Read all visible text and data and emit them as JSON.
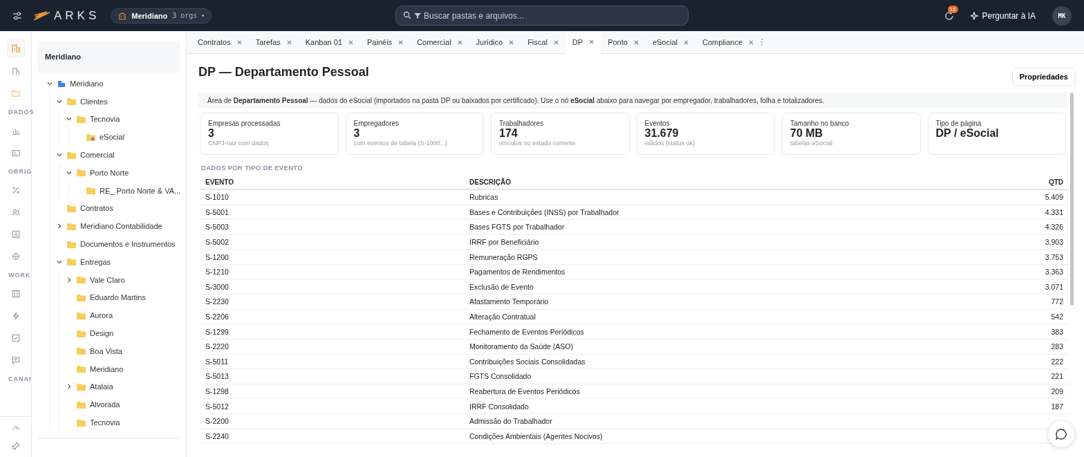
{
  "topbar": {
    "logo": "ARKS",
    "org": {
      "name": "Meridiano",
      "count": "3 orgs"
    },
    "search": {
      "placeholder": "Buscar pastas e arquivos..."
    },
    "notifications": "15",
    "ask_ai": "Perguntar à IA",
    "avatar": "MK"
  },
  "rail": {
    "sections": [
      "DADOS",
      "OBRIG",
      "WORK",
      "CANAI"
    ]
  },
  "tree": {
    "title": "Meridiano",
    "items": [
      {
        "label": "Meridiano",
        "kind": "org",
        "expanded": true,
        "children": [
          {
            "label": "Clientes",
            "kind": "folder",
            "expanded": true,
            "children": [
              {
                "label": "Tecnovia",
                "kind": "folder",
                "expanded": true,
                "children": [
                  {
                    "label": "eSocial",
                    "kind": "special"
                  }
                ]
              }
            ]
          },
          {
            "label": "Comercial",
            "kind": "folder",
            "expanded": true,
            "children": [
              {
                "label": "Porto Norte",
                "kind": "folder",
                "expanded": true,
                "children": [
                  {
                    "label": "RE_ Porto Norte & VA...",
                    "kind": "folder"
                  }
                ]
              }
            ]
          },
          {
            "label": "Contratos",
            "kind": "folder"
          },
          {
            "label": "Meridiano Contabilidade",
            "kind": "folder",
            "expanded": false
          },
          {
            "label": "Documentos e Instrumentos",
            "kind": "folder"
          },
          {
            "label": "Entregas",
            "kind": "folder",
            "expanded": true,
            "children": [
              {
                "label": "Vale Claro",
                "kind": "folder",
                "expanded": false
              },
              {
                "label": "Eduardo Martins",
                "kind": "folder"
              },
              {
                "label": "Aurora",
                "kind": "folder"
              },
              {
                "label": "Design",
                "kind": "folder"
              },
              {
                "label": "Boa Vista",
                "kind": "folder"
              },
              {
                "label": "Meridiano",
                "kind": "folder"
              },
              {
                "label": "Atalaia",
                "kind": "folder",
                "expanded": false
              },
              {
                "label": "Alvorada",
                "kind": "folder"
              },
              {
                "label": "Tecnovia",
                "kind": "folder"
              }
            ]
          }
        ]
      }
    ]
  },
  "tabs": [
    {
      "label": "Contratos",
      "selected": false
    },
    {
      "label": "Tarefas",
      "selected": false
    },
    {
      "label": "Kanban 01",
      "selected": false
    },
    {
      "label": "Painéis",
      "selected": false
    },
    {
      "label": "Comercial",
      "selected": false
    },
    {
      "label": "Jurídico",
      "selected": false
    },
    {
      "label": "Fiscal",
      "selected": false
    },
    {
      "label": "DP",
      "selected": true
    },
    {
      "label": "Ponto",
      "selected": false
    },
    {
      "label": "eSocial",
      "selected": false
    },
    {
      "label": "Compliance",
      "selected": false
    }
  ],
  "page": {
    "title": "DP — Departamento Pessoal",
    "properties_button": "Propriedades",
    "info": "Área de **Departamento Pessoal** — dados do eSocial (importados na pasta DP ou baixados por certificado). Use o nó **eSocial** abaixo para navegar por empregador, trabalhadores, folha e totalizadores.",
    "stats": [
      {
        "label": "Empresas processadas",
        "value": "3",
        "note": "CNPJ-raiz com dados"
      },
      {
        "label": "Empregadores",
        "value": "3",
        "note": "com eventos de tabela (S-1000...)"
      },
      {
        "label": "Trabalhadores",
        "value": "174",
        "note": "vínculos no estado corrente"
      },
      {
        "label": "Eventos",
        "value": "31.679",
        "note": "válidos (status ok)"
      },
      {
        "label": "Tamanho no banco",
        "value": "70 MB",
        "note": "tabelas eSocial"
      },
      {
        "label": "Tipo de página",
        "value": "DP / eSocial"
      }
    ],
    "section_title": "DADOS POR TIPO DE EVENTO",
    "table": {
      "columns": [
        "EVENTO",
        "DESCRIÇÃO",
        "QTD"
      ],
      "rows": [
        [
          "S-1010",
          "Rubricas",
          "5.409"
        ],
        [
          "S-5001",
          "Bases e Contribuições (INSS) por Trabalhador",
          "4.331"
        ],
        [
          "S-5003",
          "Bases FGTS por Trabalhador",
          "4.326"
        ],
        [
          "S-5002",
          "IRRF por Beneficiário",
          "3.903"
        ],
        [
          "S-1200",
          "Remuneração RGPS",
          "3.753"
        ],
        [
          "S-1210",
          "Pagamentos de Rendimentos",
          "3.363"
        ],
        [
          "S-3000",
          "Exclusão de Evento",
          "3.071"
        ],
        [
          "S-2230",
          "Afastamento Temporário",
          "772"
        ],
        [
          "S-2206",
          "Alteração Contratual",
          "542"
        ],
        [
          "S-1299",
          "Fechamento de Eventos Periódicos",
          "383"
        ],
        [
          "S-2220",
          "Monitoramento da Saúde (ASO)",
          "283"
        ],
        [
          "S-5011",
          "Contribuições Sociais Consolidadas",
          "222"
        ],
        [
          "S-5013",
          "FGTS Consolidado",
          "221"
        ],
        [
          "S-1298",
          "Reabertura de Eventos Periódicos",
          "209"
        ],
        [
          "S-5012",
          "IRRF Consolidado",
          "187"
        ],
        [
          "S-2200",
          "Admissão do Trabalhador"
        ],
        [
          "S-2240",
          "Condições Ambientais (Agentes Nocivos)"
        ]
      ]
    }
  }
}
